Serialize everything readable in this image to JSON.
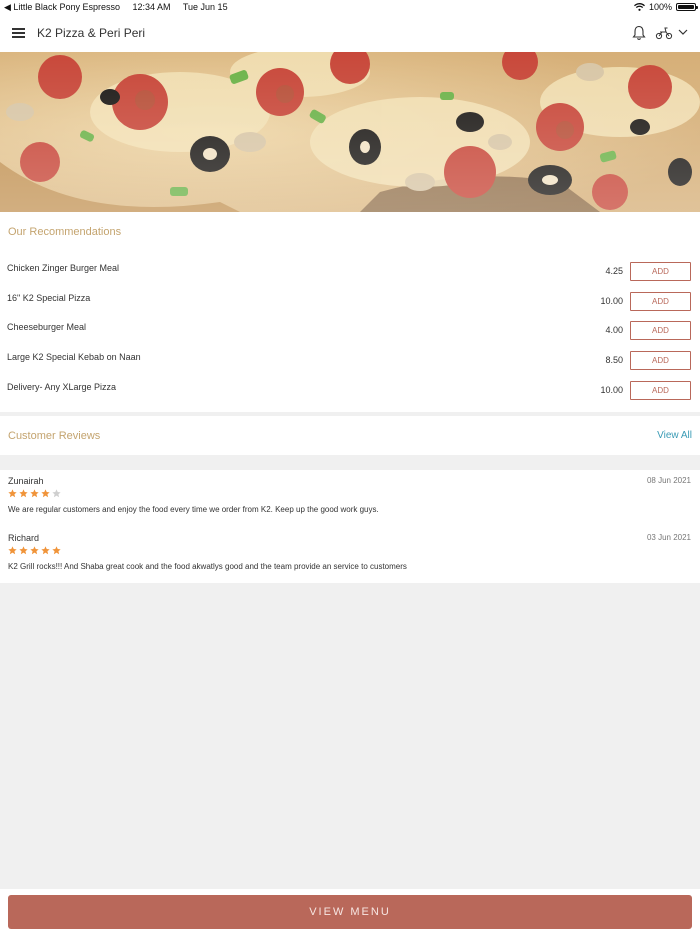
{
  "status_bar": {
    "back_app": "◀ Little Black Pony Espresso",
    "time": "12:34 AM",
    "date": "Tue Jun 15",
    "battery": "100%"
  },
  "nav": {
    "title": "K2 Pizza & Peri Peri",
    "icons": [
      "menu-icon",
      "bell-icon",
      "delivery-scooter-icon",
      "chevron-down-icon"
    ]
  },
  "recommendations": {
    "title": "Our Recommendations",
    "add_label": "ADD",
    "items": [
      {
        "name": "Chicken Zinger Burger Meal",
        "price": "4.25"
      },
      {
        "name": "16\" K2 Special Pizza",
        "price": "10.00"
      },
      {
        "name": "Cheeseburger Meal",
        "price": "4.00"
      },
      {
        "name": "Large K2 Special Kebab on Naan",
        "price": "8.50"
      },
      {
        "name": "Delivery- Any XLarge Pizza",
        "price": "10.00"
      }
    ]
  },
  "reviews": {
    "title": "Customer Reviews",
    "view_all": "View All",
    "star_color": "#f0943a",
    "star_empty_color": "#cfcfcf",
    "items": [
      {
        "name": "Zunairah",
        "date": "08 Jun 2021",
        "rating": 4,
        "text": "We are regular customers and enjoy the food every time we order from K2. Keep up the good work guys."
      },
      {
        "name": "Richard",
        "date": "03 Jun 2021",
        "rating": 5,
        "text": "K2 Grill rocks!!! And Shaba great cook and the food akwatlys good and  the team  provide an  service to customers"
      }
    ]
  },
  "bottom": {
    "view_menu": "VIEW MENU"
  },
  "colors": {
    "accent": "#b9685a",
    "section_title": "#c4a46f",
    "link": "#3a9bb5"
  }
}
